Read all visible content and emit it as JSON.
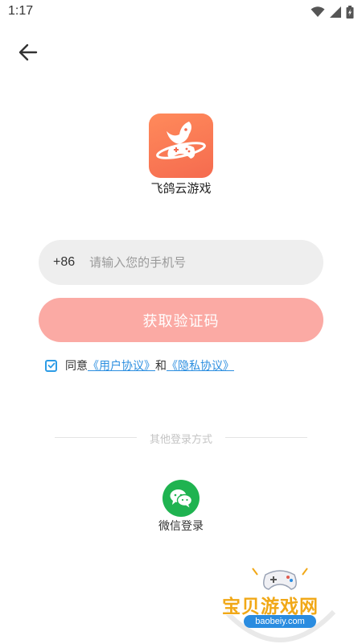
{
  "status_bar": {
    "time": "1:17",
    "icons": [
      "wifi-icon",
      "signal-icon",
      "battery-icon"
    ]
  },
  "back_icon": "arrow-left-icon",
  "app": {
    "name": "飞鸽云游戏",
    "logo_colors": [
      "#ff8a5b",
      "#f56b4f"
    ]
  },
  "phone": {
    "country_code": "+86",
    "placeholder": "请输入您的手机号",
    "value": ""
  },
  "get_code": {
    "label": "获取验证码",
    "color": "#fbaaa4",
    "enabled": false
  },
  "agreement": {
    "checked": true,
    "prefix": "同意",
    "user_agreement": "《用户协议》",
    "and": "和",
    "privacy_agreement": "《隐私协议》"
  },
  "other_login": {
    "label": "其他登录方式",
    "wechat_label": "微信登录",
    "wechat_color": "#1fb350"
  },
  "watermark": {
    "title": "宝贝游戏网",
    "url": "baobeiy.com"
  }
}
